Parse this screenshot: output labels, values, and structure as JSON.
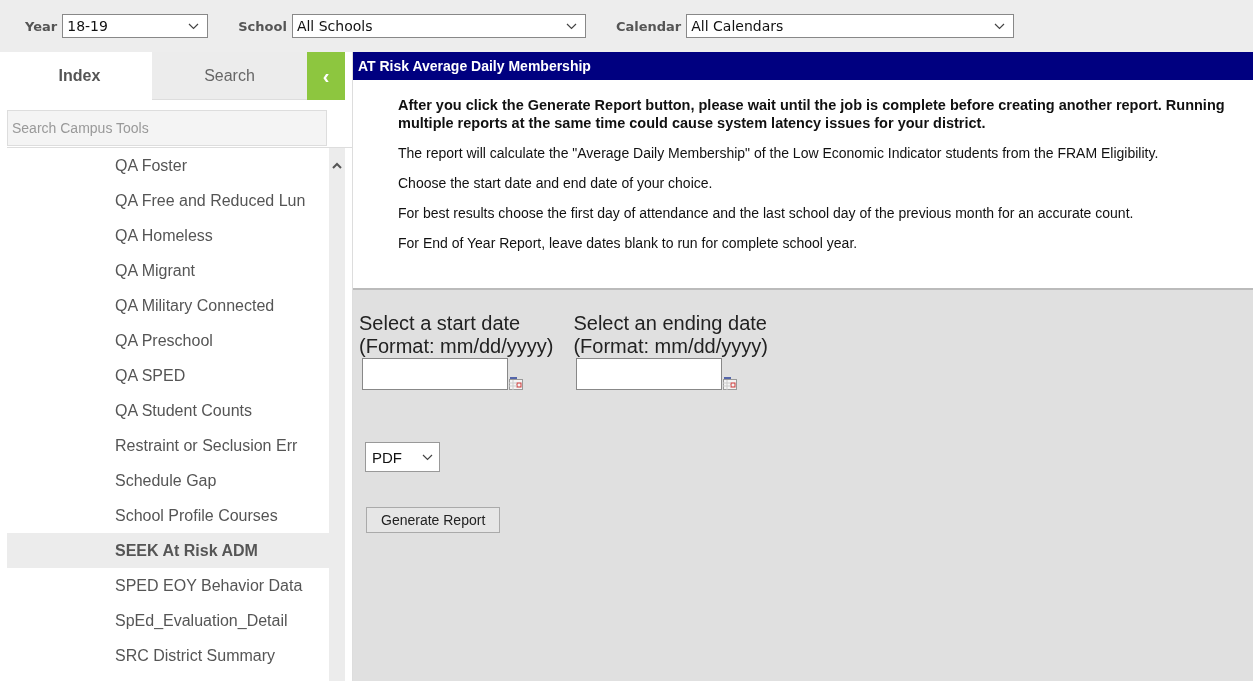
{
  "filters": [
    {
      "label": "Year",
      "value": "18-19",
      "kind": "short"
    },
    {
      "label": "School",
      "value": "All Schools",
      "kind": "medium"
    },
    {
      "label": "Calendar",
      "value": "All Calendars",
      "kind": "long"
    }
  ],
  "sidebar": {
    "tabs": [
      {
        "label": "Index",
        "selected": true
      },
      {
        "label": "Search",
        "selected": false
      }
    ],
    "collapse_button": "‹",
    "search": {
      "placeholder": "Search Campus Tools"
    },
    "items": [
      {
        "label": "QA Foster",
        "selected": false
      },
      {
        "label": "QA Free and Reduced Lun",
        "selected": false
      },
      {
        "label": "QA Homeless",
        "selected": false
      },
      {
        "label": "QA Migrant",
        "selected": false
      },
      {
        "label": "QA Military Connected",
        "selected": false
      },
      {
        "label": "QA Preschool",
        "selected": false
      },
      {
        "label": "QA SPED",
        "selected": false
      },
      {
        "label": "QA Student Counts",
        "selected": false
      },
      {
        "label": "Restraint or Seclusion Err",
        "selected": false
      },
      {
        "label": "Schedule Gap",
        "selected": false
      },
      {
        "label": "School Profile Courses",
        "selected": false
      },
      {
        "label": "SEEK At Risk ADM",
        "selected": true
      },
      {
        "label": "SPED EOY Behavior Data",
        "selected": false
      },
      {
        "label": "SpEd_Evaluation_Detail",
        "selected": false
      },
      {
        "label": "SRC District Summary",
        "selected": false
      }
    ]
  },
  "report": {
    "title": "AT Risk Average Daily Membership",
    "paragraphs": [
      {
        "text": "After you click the Generate Report button, please wait until the job is complete before creating another report. Running multiple reports at the same time could cause system latency issues for your district.",
        "kind": "warning"
      },
      {
        "text": "The report will calculate the \"Average Daily Membership\" of the Low Economic Indicator students from the FRAM Eligibility.",
        "kind": "plain"
      },
      {
        "text": "Choose the start date and end date of your choice.",
        "kind": "plain"
      },
      {
        "text": "For best results choose the first day of attendance and the last school day of the previous month for an accurate count.",
        "kind": "plain"
      },
      {
        "text": "For End of Year Report, leave dates blank to run for complete school year.",
        "kind": "plain"
      }
    ],
    "dates": [
      {
        "label": "Select a start date",
        "format": "(Format: mm/dd/yyyy)"
      },
      {
        "label": "Select an ending date",
        "format": "(Format: mm/dd/yyyy)"
      }
    ],
    "format": "PDF",
    "button": "Generate Report"
  }
}
